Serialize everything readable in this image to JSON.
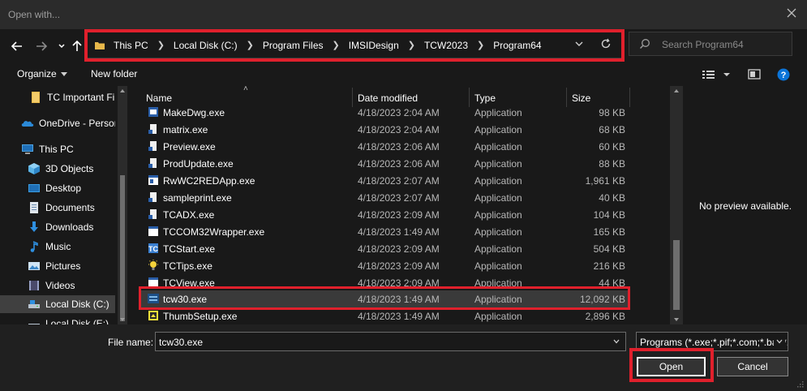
{
  "window": {
    "title": "Open with..."
  },
  "address": {
    "crumbs": [
      "This PC",
      "Local Disk (C:)",
      "Program Files",
      "IMSIDesign",
      "TCW2023",
      "Program64"
    ]
  },
  "search": {
    "placeholder": "Search Program64"
  },
  "toolbar": {
    "organize_label": "Organize",
    "new_folder_label": "New folder"
  },
  "sidebar": {
    "items": [
      {
        "label": "TC Important File",
        "icon": "folder-icon"
      },
      {
        "label": "OneDrive - Persor",
        "icon": "onedrive-icon"
      },
      {
        "label": "This PC",
        "icon": "computer-icon"
      },
      {
        "label": "3D Objects",
        "icon": "3d-objects-icon"
      },
      {
        "label": "Desktop",
        "icon": "desktop-icon"
      },
      {
        "label": "Documents",
        "icon": "documents-icon"
      },
      {
        "label": "Downloads",
        "icon": "downloads-icon"
      },
      {
        "label": "Music",
        "icon": "music-icon"
      },
      {
        "label": "Pictures",
        "icon": "pictures-icon"
      },
      {
        "label": "Videos",
        "icon": "videos-icon"
      },
      {
        "label": "Local Disk (C:)",
        "icon": "drive-icon"
      },
      {
        "label": "Local Disk (E:)",
        "icon": "drive-icon"
      }
    ]
  },
  "columns": {
    "name": "Name",
    "date": "Date modified",
    "type": "Type",
    "size": "Size"
  },
  "files": [
    {
      "name": "MakeDwg.exe",
      "date": "4/18/2023 2:04 AM",
      "type": "Application",
      "size": "98 KB"
    },
    {
      "name": "matrix.exe",
      "date": "4/18/2023 2:04 AM",
      "type": "Application",
      "size": "68 KB"
    },
    {
      "name": "Preview.exe",
      "date": "4/18/2023 2:06 AM",
      "type": "Application",
      "size": "60 KB"
    },
    {
      "name": "ProdUpdate.exe",
      "date": "4/18/2023 2:06 AM",
      "type": "Application",
      "size": "88 KB"
    },
    {
      "name": "RwWC2REDApp.exe",
      "date": "4/18/2023 2:07 AM",
      "type": "Application",
      "size": "1,961 KB"
    },
    {
      "name": "sampleprint.exe",
      "date": "4/18/2023 2:07 AM",
      "type": "Application",
      "size": "40 KB"
    },
    {
      "name": "TCADX.exe",
      "date": "4/18/2023 2:09 AM",
      "type": "Application",
      "size": "104 KB"
    },
    {
      "name": "TCCOM32Wrapper.exe",
      "date": "4/18/2023 1:49 AM",
      "type": "Application",
      "size": "165 KB"
    },
    {
      "name": "TCStart.exe",
      "date": "4/18/2023 2:09 AM",
      "type": "Application",
      "size": "504 KB"
    },
    {
      "name": "TCTips.exe",
      "date": "4/18/2023 2:09 AM",
      "type": "Application",
      "size": "216 KB"
    },
    {
      "name": "TCView.exe",
      "date": "4/18/2023 2:09 AM",
      "type": "Application",
      "size": "44 KB"
    },
    {
      "name": "tcw30.exe",
      "date": "4/18/2023 1:49 AM",
      "type": "Application",
      "size": "12,092 KB"
    },
    {
      "name": "ThumbSetup.exe",
      "date": "4/18/2023 1:49 AM",
      "type": "Application",
      "size": "2,896 KB"
    }
  ],
  "preview": {
    "message": "No preview available."
  },
  "footer": {
    "filename_label": "File name:",
    "filename_value": "tcw30.exe",
    "filter_value": "Programs (*.exe;*.pif;*.com;*.bat;*.cmd)",
    "open_label": "Open",
    "cancel_label": "Cancel"
  },
  "colors": {
    "highlight": "#e0202c",
    "folder": "#e8b84a",
    "accent": "#0b74d8"
  }
}
